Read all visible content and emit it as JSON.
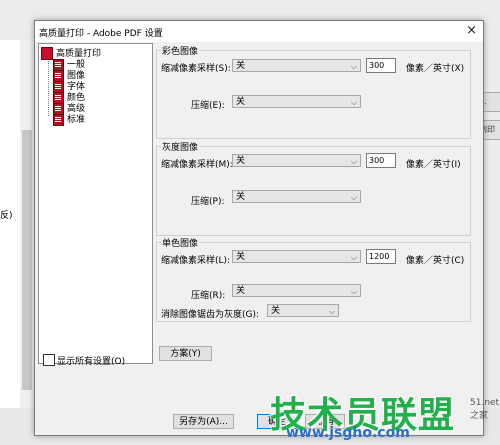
{
  "background": {
    "left_text": "反)",
    "right_buttons": [
      "...",
      "剧印"
    ],
    "right_fragment": "51.net",
    "right_fragment2": "之家"
  },
  "dialog": {
    "title": "高质量打印 - Adobe PDF 设置",
    "close": "×",
    "tree": {
      "root": "高质量打印",
      "items": [
        "一般",
        "图像",
        "字体",
        "颜色",
        "高级",
        "标准"
      ]
    },
    "show_all_label": "显示所有设置(O)",
    "color": {
      "title": "彩色图像",
      "downsample_label": "缩减像素采样(S):",
      "downsample_value": "关",
      "ppi_value": "300",
      "ppi_unit": "像素／英寸(X)",
      "compress_label": "压缩(E):",
      "compress_value": "关"
    },
    "gray": {
      "title": "灰度图像",
      "downsample_label": "缩减像素采样(M):",
      "downsample_value": "关",
      "ppi_value": "300",
      "ppi_unit": "像素／英寸(I)",
      "compress_label": "压缩(P):",
      "compress_value": "关"
    },
    "mono": {
      "title": "单色图像",
      "downsample_label": "缩减像素采样(L):",
      "downsample_value": "关",
      "ppi_value": "1200",
      "ppi_unit": "像素／英寸(C)",
      "compress_label": "压缩(R):",
      "compress_value": "关",
      "antialias_label": "消除图像锯齿为灰度(G):",
      "antialias_value": "关"
    },
    "policy_button": "方案(Y)",
    "save_as_button": "另存为(A)...",
    "ok_button": "确定",
    "cancel_button": "取消"
  },
  "watermark": {
    "main": "技术员联盟",
    "url": "www.jsgho.com"
  },
  "colors": {
    "accent_red": "#c8102e",
    "watermark_green": "#22b04c",
    "watermark_blue": "#2a6fc9"
  }
}
